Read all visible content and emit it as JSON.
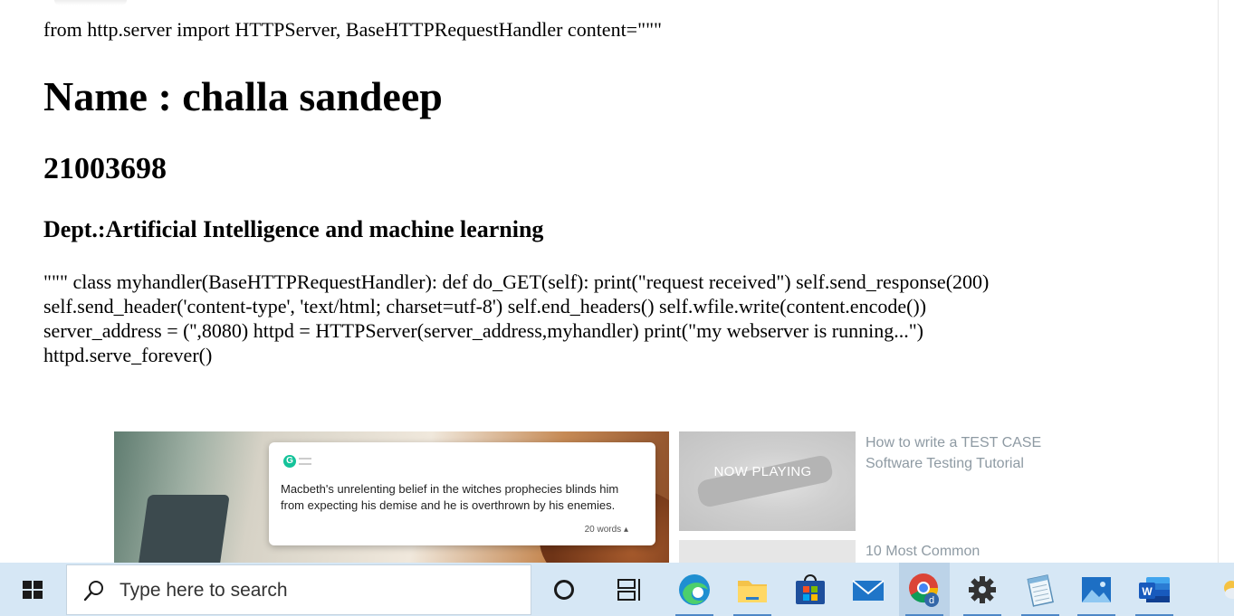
{
  "page": {
    "import_line": "from http.server import HTTPServer, BaseHTTPRequestHandler content=\"\"\"",
    "name_heading": "Name : challa sandeep",
    "roll_number": "21003698",
    "department": "Dept.:Artificial Intelligence and machine learning",
    "code_lines": [
      "\"\"\" class myhandler(BaseHTTPRequestHandler): def do_GET(self): print(\"request received\") self.send_response(200)",
      "self.send_header('content-type', 'text/html; charset=utf-8') self.end_headers() self.wfile.write(content.encode())",
      "server_address = ('',8080) httpd = HTTPServer(server_address,myhandler) print(\"my webserver is running...\")",
      "httpd.serve_forever()"
    ]
  },
  "ad": {
    "card_text": "Macbeth's unrelenting belief in the witches prophecies blinds him from expecting his demise and he is overthrown by his enemies.",
    "word_count": "20 words",
    "word_count_arrow": "▴"
  },
  "videos": {
    "now_playing": "NOW PLAYING",
    "items": [
      {
        "title_line1": "How to write a TEST CASE",
        "title_line2": "Software Testing Tutorial"
      },
      {
        "title_line1": "10 Most Common",
        "title_line2": ""
      }
    ]
  },
  "taskbar": {
    "search_placeholder": "Type here to search",
    "icons": [
      "start-icon",
      "search-icon",
      "cortana-icon",
      "task-view-icon",
      "edge-icon",
      "file-explorer-icon",
      "microsoft-store-icon",
      "mail-icon",
      "chrome-icon",
      "settings-icon",
      "notepad-icon",
      "photos-icon",
      "word-icon"
    ],
    "colors": {
      "taskbar_bg": "#d6e7f5",
      "active_indicator": "#4d87c7"
    }
  }
}
